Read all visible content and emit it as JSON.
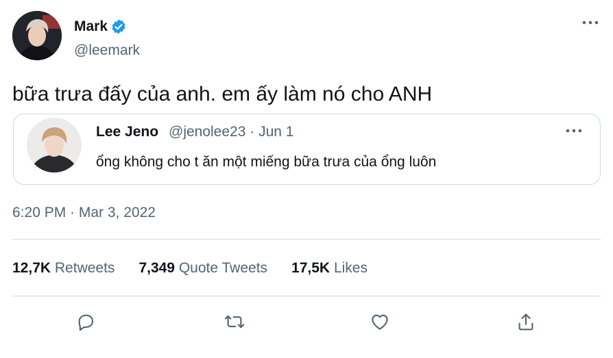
{
  "tweet": {
    "author": {
      "name": "Mark",
      "handle": "@leemark",
      "verified": true
    },
    "text": "bữa trưa đấy của anh. em ấy làm nó cho ANH",
    "timestamp": "6:20 PM · Mar 3, 2022"
  },
  "quoted_tweet": {
    "author": {
      "name": "Lee Jeno",
      "handle": "@jenolee23 · Jun 1"
    },
    "text": "ổng không cho t ăn một miếng bữa trưa của ổng luôn"
  },
  "stats": {
    "retweets": {
      "count": "12,7K",
      "label": "Retweets"
    },
    "quote_tweets": {
      "count": "7,349",
      "label": "Quote Tweets"
    },
    "likes": {
      "count": "17,5K",
      "label": "Likes"
    }
  },
  "icons": {
    "verified": "verified-badge-icon",
    "more": "more-horizontal-icon",
    "reply": "reply-icon",
    "retweet": "retweet-icon",
    "like": "heart-icon",
    "share": "share-icon"
  },
  "colors": {
    "verified": "#1d9bf0",
    "secondary_text": "#536471",
    "border": "#cfd9de"
  }
}
